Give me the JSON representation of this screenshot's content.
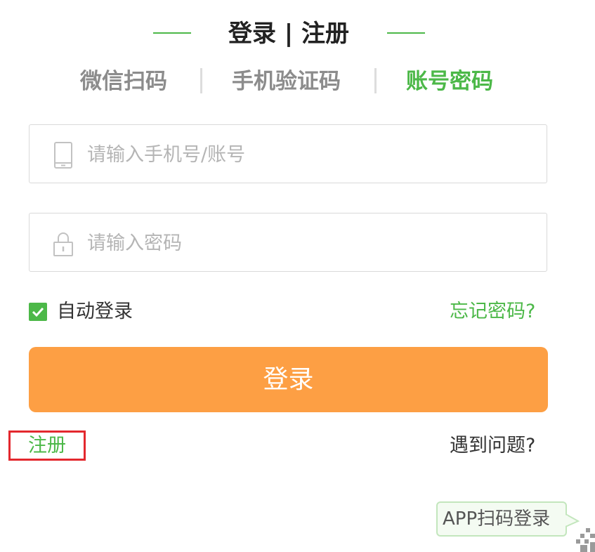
{
  "header": {
    "title": "登录 | 注册"
  },
  "tabs": [
    {
      "label": "微信扫码",
      "active": false
    },
    {
      "label": "手机验证码",
      "active": false
    },
    {
      "label": "账号密码",
      "active": true
    }
  ],
  "form": {
    "account": {
      "placeholder": "请输入手机号/账号",
      "value": "",
      "icon": "phone-icon"
    },
    "password": {
      "placeholder": "请输入密码",
      "value": "",
      "icon": "lock-icon"
    },
    "remember_label": "自动登录",
    "remember_checked": true,
    "forgot_label": "忘记密码?",
    "submit_label": "登录"
  },
  "footer": {
    "register_label": "注册",
    "help_label": "遇到问题?"
  },
  "app_login": {
    "label": "APP扫码登录",
    "icon": "qr-code-icon"
  },
  "colors": {
    "accent": "#4cb848",
    "button": "#fd9f44",
    "highlight_box": "#e3282e",
    "tab_inactive": "#8c8c8c"
  }
}
